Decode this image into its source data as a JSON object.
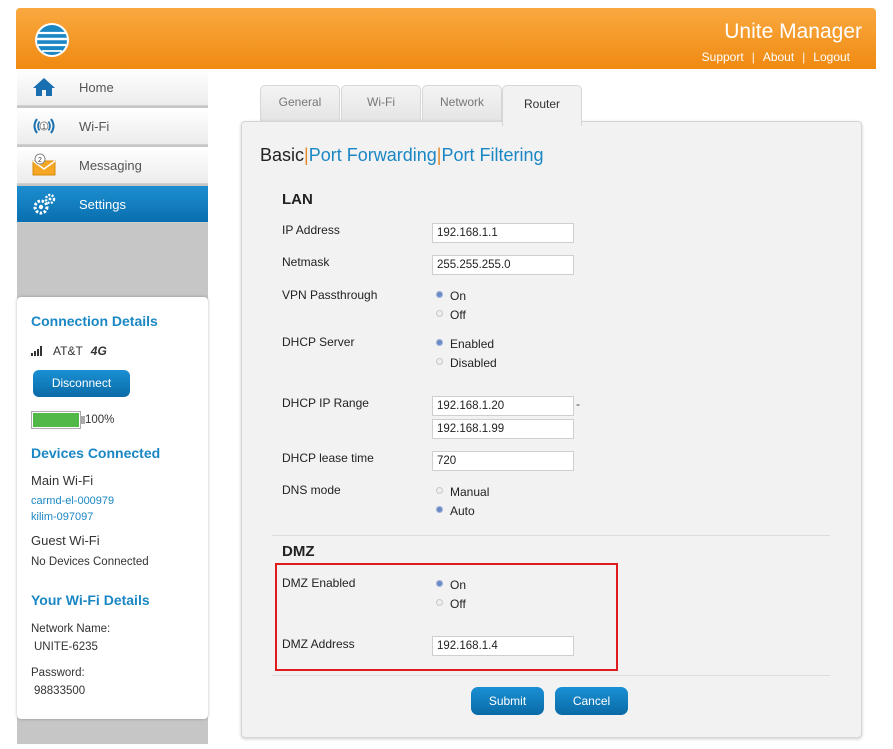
{
  "header": {
    "app_title": "Unite Manager",
    "links": [
      "Support",
      "About",
      "Logout"
    ],
    "brand_color": "#f08a12"
  },
  "nav": {
    "items": [
      {
        "label": "Home",
        "icon": "home-icon"
      },
      {
        "label": "Wi-Fi",
        "icon": "wifi-icon"
      },
      {
        "label": "Messaging",
        "icon": "messaging-icon"
      },
      {
        "label": "Settings",
        "icon": "settings-icon",
        "active": true
      }
    ]
  },
  "connection": {
    "title": "Connection Details",
    "carrier": "AT&T",
    "disconnect_label": "Disconnect",
    "battery": "100%",
    "battery_level": 1.0
  },
  "devices": {
    "title": "Devices Connected",
    "main_wifi_label": "Main Wi-Fi",
    "main_devices": [
      "carmd-el-000979",
      "kilim-097097"
    ],
    "guest_wifi_label": "Guest Wi-Fi",
    "guest_status": "No Devices Connected"
  },
  "wifi_details": {
    "title": "Your Wi-Fi Details",
    "network_name_label": "Network Name:",
    "network_name": "UNITE-6235",
    "password_label": "Password:",
    "password": "98833500"
  },
  "tabs": [
    "General",
    "Wi-Fi",
    "Network",
    "Router"
  ],
  "subnav": {
    "current": "Basic",
    "links": [
      "Port Forwarding",
      "Port Filtering"
    ]
  },
  "lan": {
    "title": "LAN",
    "ip_address_label": "IP Address",
    "ip_address": "192.168.1.1",
    "netmask_label": "Netmask",
    "netmask": "255.255.255.0",
    "vpn_label": "VPN Passthrough",
    "vpn_on": "On",
    "vpn_off": "Off",
    "dhcp_server_label": "DHCP Server",
    "dhcp_enabled": "Enabled",
    "dhcp_disabled": "Disabled",
    "dhcp_range_label": "DHCP IP Range",
    "dhcp_range_start": "192.168.1.20",
    "dhcp_range_dash": "-",
    "dhcp_range_end": "192.168.1.99",
    "lease_label": "DHCP lease time",
    "lease_value": "720",
    "dns_label": "DNS mode",
    "dns_manual": "Manual",
    "dns_auto": "Auto"
  },
  "dmz": {
    "title": "DMZ",
    "enabled_label": "DMZ Enabled",
    "on": "On",
    "off": "Off",
    "address_label": "DMZ Address",
    "address": "192.168.1.4",
    "highlight_color": "#e01b1b"
  },
  "buttons": {
    "submit": "Submit",
    "cancel": "Cancel"
  }
}
